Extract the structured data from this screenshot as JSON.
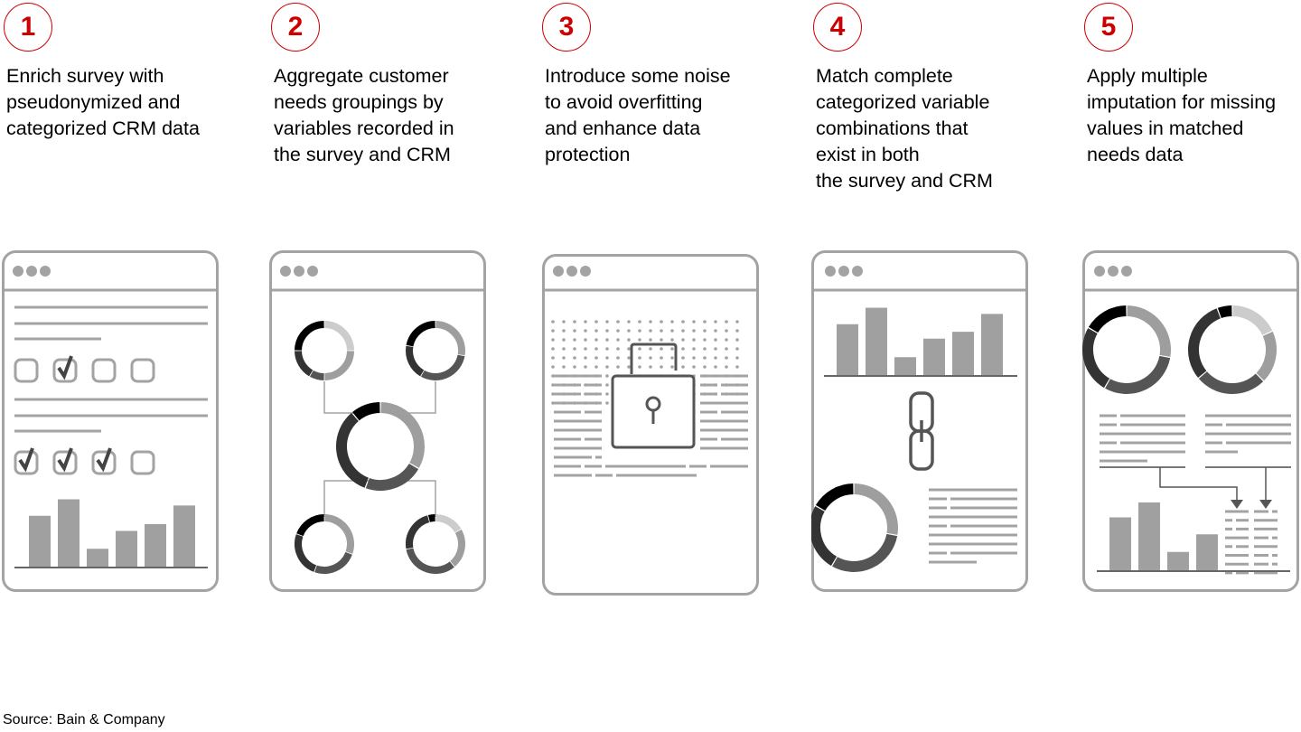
{
  "accent_color": "#cc0000",
  "steps": [
    {
      "number": "1",
      "description": "Enrich survey with\npseudonymized and\ncategorized CRM data",
      "illustration": "survey-form-with-checkboxes-and-bar-chart",
      "checkbox_rows": [
        [
          false,
          true,
          false,
          false
        ],
        [
          true,
          true,
          true,
          false
        ]
      ],
      "bar_values": [
        0.74,
        0.98,
        0.26,
        0.52,
        0.62,
        0.89
      ]
    },
    {
      "number": "2",
      "description": "Aggregate customer\nneeds groupings by\nvariables recorded in\nthe survey and CRM",
      "illustration": "donut-charts-aggregated-into-central-donut"
    },
    {
      "number": "3",
      "description": "Introduce some noise\nto avoid overfitting\nand enhance data\nprotection",
      "illustration": "noise-dots-with-padlock"
    },
    {
      "number": "4",
      "description": "Match complete\ncategorized variable\ncombinations that\nexist in both\nthe survey and CRM",
      "illustration": "bar-chart-linked-to-donut",
      "bar_values": [
        0.74,
        0.98,
        0.26,
        0.53,
        0.63,
        0.89
      ]
    },
    {
      "number": "5",
      "description": "Apply multiple\nimputation for missing\nvalues in matched\nneeds data",
      "illustration": "donuts-feeding-into-table-and-bar-chart",
      "bar_values": [
        0.78,
        1.0,
        0.27,
        0.53
      ]
    }
  ],
  "source": "Source: Bain & Company"
}
